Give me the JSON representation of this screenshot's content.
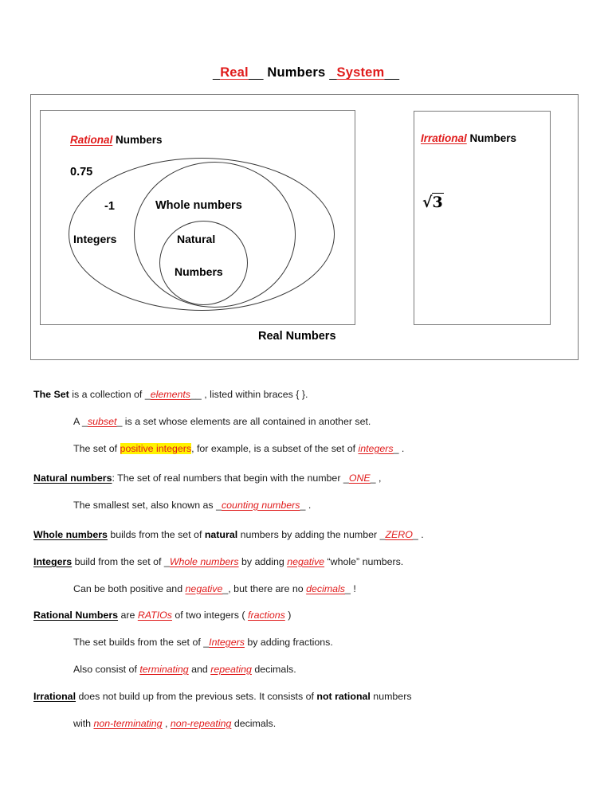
{
  "title": {
    "blank1": "Real",
    "static1": "Numbers",
    "blank2": "System",
    "pad_left": "_",
    "pad_right": "__"
  },
  "colors": {
    "fill_in_red": "#E01B1B",
    "highlight_yellow": "#FFF200",
    "border_gray": "#7a7a7a",
    "ellipse_stroke": "#3a3a3a"
  },
  "diagram": {
    "rational_label_blank": "Rational",
    "rational_label_static": "Numbers",
    "irrational_label_blank": "Irrational",
    "irrational_label_static": "Numbers",
    "irrational_example_symbol": "√",
    "irrational_example_radicand": "3",
    "sample_decimal": "0.75",
    "sample_negative": "-1",
    "set_integers": "Integers",
    "set_whole": "Whole numbers",
    "set_natural_line1": "Natural",
    "set_natural_line2": "Numbers",
    "set_real": "Real Numbers"
  },
  "notes": {
    "lines": [
      {
        "indent": false,
        "parts": [
          {
            "t": "The Set",
            "s": "bold"
          },
          {
            "t": " is a collection of ",
            "s": "plain"
          },
          {
            "t": "_",
            "s": "plain"
          },
          {
            "t": "elements",
            "s": "blank"
          },
          {
            "t": "__",
            "s": "plain"
          },
          {
            "t": " , listed within braces { }.",
            "s": "plain"
          }
        ]
      },
      {
        "indent": true,
        "parts": [
          {
            "t": "A ",
            "s": "plain"
          },
          {
            "t": "_",
            "s": "plain"
          },
          {
            "t": "subset",
            "s": "blank"
          },
          {
            "t": "_",
            "s": "plain"
          },
          {
            "t": " is a set whose elements are all contained in another set.",
            "s": "plain"
          }
        ]
      },
      {
        "indent": true,
        "parts": [
          {
            "t": "The set of ",
            "s": "plain"
          },
          {
            "t": "positive integers",
            "s": "highlight"
          },
          {
            "t": ", for example, is a subset of the set of ",
            "s": "plain"
          },
          {
            "t": "integers",
            "s": "blank"
          },
          {
            "t": "_",
            "s": "plain"
          },
          {
            "t": " .",
            "s": "plain"
          }
        ]
      },
      {
        "indent": false,
        "parts": [
          {
            "t": "Natural numbers",
            "s": "underline"
          },
          {
            "t": ": The set of real numbers that begin with the number ",
            "s": "plain"
          },
          {
            "t": "_",
            "s": "plain"
          },
          {
            "t": "ONE",
            "s": "blank"
          },
          {
            "t": "_",
            "s": "plain"
          },
          {
            "t": " ,",
            "s": "plain"
          }
        ]
      },
      {
        "indent": true,
        "parts": [
          {
            "t": "The smallest set, also known as ",
            "s": "plain"
          },
          {
            "t": "_",
            "s": "plain"
          },
          {
            "t": "counting numbers",
            "s": "blank"
          },
          {
            "t": "_",
            "s": "plain"
          },
          {
            "t": " .",
            "s": "plain"
          }
        ]
      },
      {
        "indent": false,
        "parts": [
          {
            "t": "Whole numbers",
            "s": "underline"
          },
          {
            "t": " builds from the set of ",
            "s": "plain"
          },
          {
            "t": "natural",
            "s": "bold"
          },
          {
            "t": " numbers by adding the number ",
            "s": "plain"
          },
          {
            "t": "_",
            "s": "plain"
          },
          {
            "t": "ZERO",
            "s": "blank"
          },
          {
            "t": "_",
            "s": "plain"
          },
          {
            "t": " .",
            "s": "plain"
          }
        ]
      },
      {
        "indent": false,
        "parts": [
          {
            "t": "Integers",
            "s": "underline"
          },
          {
            "t": " build from the set of ",
            "s": "plain"
          },
          {
            "t": "_",
            "s": "plain"
          },
          {
            "t": "Whole numbers",
            "s": "blank"
          },
          {
            "t": " by adding ",
            "s": "plain"
          },
          {
            "t": "negative",
            "s": "blank"
          },
          {
            "t": " “whole” numbers.",
            "s": "plain"
          }
        ]
      },
      {
        "indent": true,
        "parts": [
          {
            "t": "Can be both positive and ",
            "s": "plain"
          },
          {
            "t": "negative",
            "s": "blank"
          },
          {
            "t": "_",
            "s": "plain"
          },
          {
            "t": ", but there are no ",
            "s": "plain"
          },
          {
            "t": "decimals",
            "s": "blank"
          },
          {
            "t": "_",
            "s": "plain"
          },
          {
            "t": " !",
            "s": "plain"
          }
        ]
      },
      {
        "indent": false,
        "parts": [
          {
            "t": "Rational Numbers",
            "s": "underline"
          },
          {
            "t": " are ",
            "s": "plain"
          },
          {
            "t": "RATIOs",
            "s": "blank"
          },
          {
            "t": " of two integers ( ",
            "s": "plain"
          },
          {
            "t": "fractions",
            "s": "blank"
          },
          {
            "t": " )",
            "s": "plain"
          }
        ]
      },
      {
        "indent": true,
        "parts": [
          {
            "t": "The set builds from the set of ",
            "s": "plain"
          },
          {
            "t": "_",
            "s": "plain"
          },
          {
            "t": "Integers",
            "s": "blank"
          },
          {
            "t": " by adding fractions.",
            "s": "plain"
          }
        ]
      },
      {
        "indent": true,
        "parts": [
          {
            "t": "Also consist of ",
            "s": "plain"
          },
          {
            "t": "terminating",
            "s": "blank"
          },
          {
            "t": " and ",
            "s": "plain"
          },
          {
            "t": "repeating",
            "s": "blank"
          },
          {
            "t": " decimals.",
            "s": "plain"
          }
        ]
      },
      {
        "indent": false,
        "parts": [
          {
            "t": "Irrational",
            "s": "underline"
          },
          {
            "t": " does not build up from the previous sets. It consists of ",
            "s": "plain"
          },
          {
            "t": "not rational",
            "s": "bold"
          },
          {
            "t": " numbers",
            "s": "plain"
          }
        ]
      },
      {
        "indent": true,
        "parts": [
          {
            "t": "with ",
            "s": "plain"
          },
          {
            "t": "non-terminating",
            "s": "blank"
          },
          {
            "t": " , ",
            "s": "plain"
          },
          {
            "t": "non-repeating",
            "s": "blank"
          },
          {
            "t": " decimals.",
            "s": "plain"
          }
        ]
      }
    ]
  }
}
